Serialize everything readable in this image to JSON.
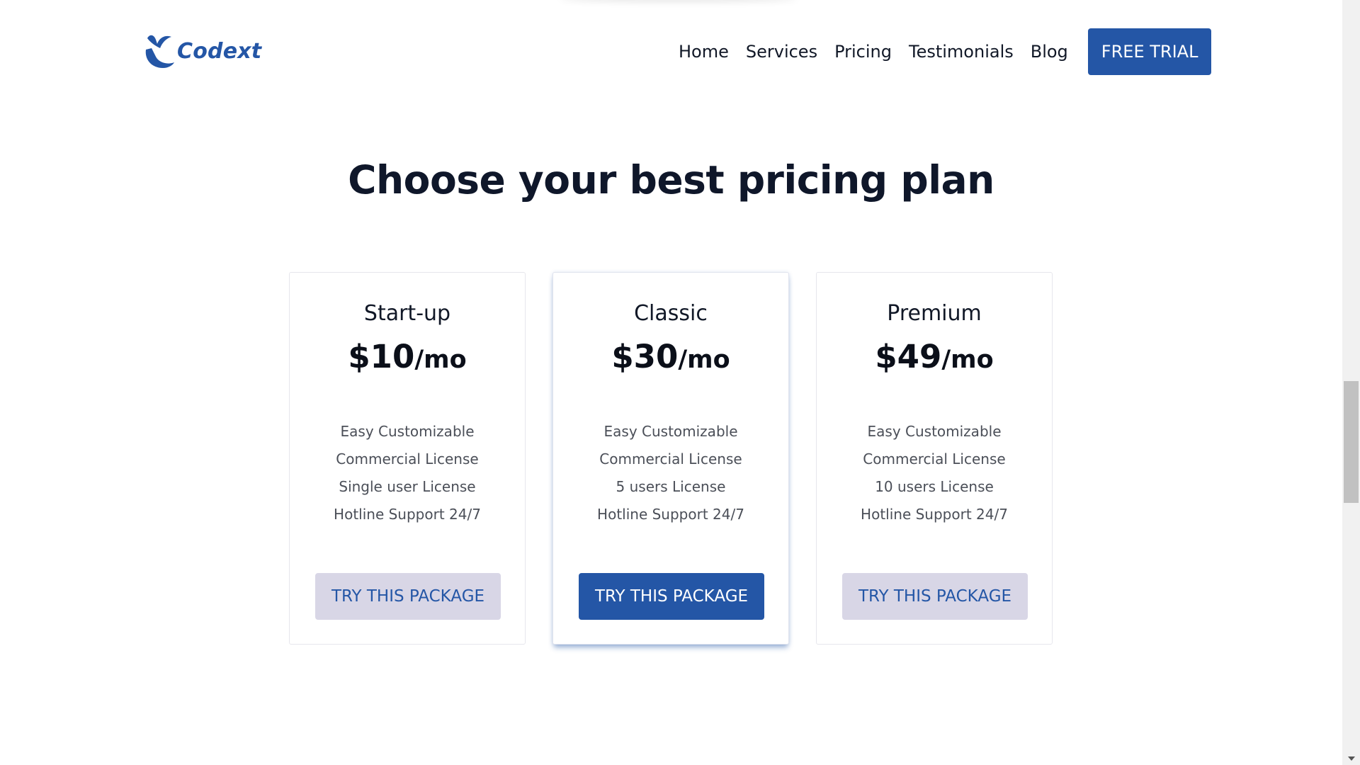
{
  "brand": {
    "name": "Codext",
    "color": "#2456a6"
  },
  "nav": {
    "items": [
      {
        "label": "Home"
      },
      {
        "label": "Services"
      },
      {
        "label": "Pricing"
      },
      {
        "label": "Testimonials"
      },
      {
        "label": "Blog"
      }
    ],
    "cta_label": "FREE TRIAL"
  },
  "pricing": {
    "title": "Choose your best pricing plan",
    "plans": [
      {
        "name": "Start-up",
        "price": "$10",
        "unit": "/mo",
        "features": [
          "Easy Customizable",
          "Commercial License",
          "Single user License",
          "Hotline Support 24/7"
        ],
        "button_label": "TRY THIS PACKAGE",
        "featured": false
      },
      {
        "name": "Classic",
        "price": "$30",
        "unit": "/mo",
        "features": [
          "Easy Customizable",
          "Commercial License",
          "5 users License",
          "Hotline Support 24/7"
        ],
        "button_label": "TRY THIS PACKAGE",
        "featured": true
      },
      {
        "name": "Premium",
        "price": "$49",
        "unit": "/mo",
        "features": [
          "Easy Customizable",
          "Commercial License",
          "10 users License",
          "Hotline Support 24/7"
        ],
        "button_label": "TRY THIS PACKAGE",
        "featured": false
      }
    ]
  },
  "colors": {
    "primary": "#2456a6",
    "button_light_bg": "#d8d6e6",
    "text_dark": "#111827",
    "text_muted": "#4b4f58"
  },
  "icons": {
    "logo": "codext-logo-icon",
    "scroll_down": "chevron-down-icon"
  }
}
